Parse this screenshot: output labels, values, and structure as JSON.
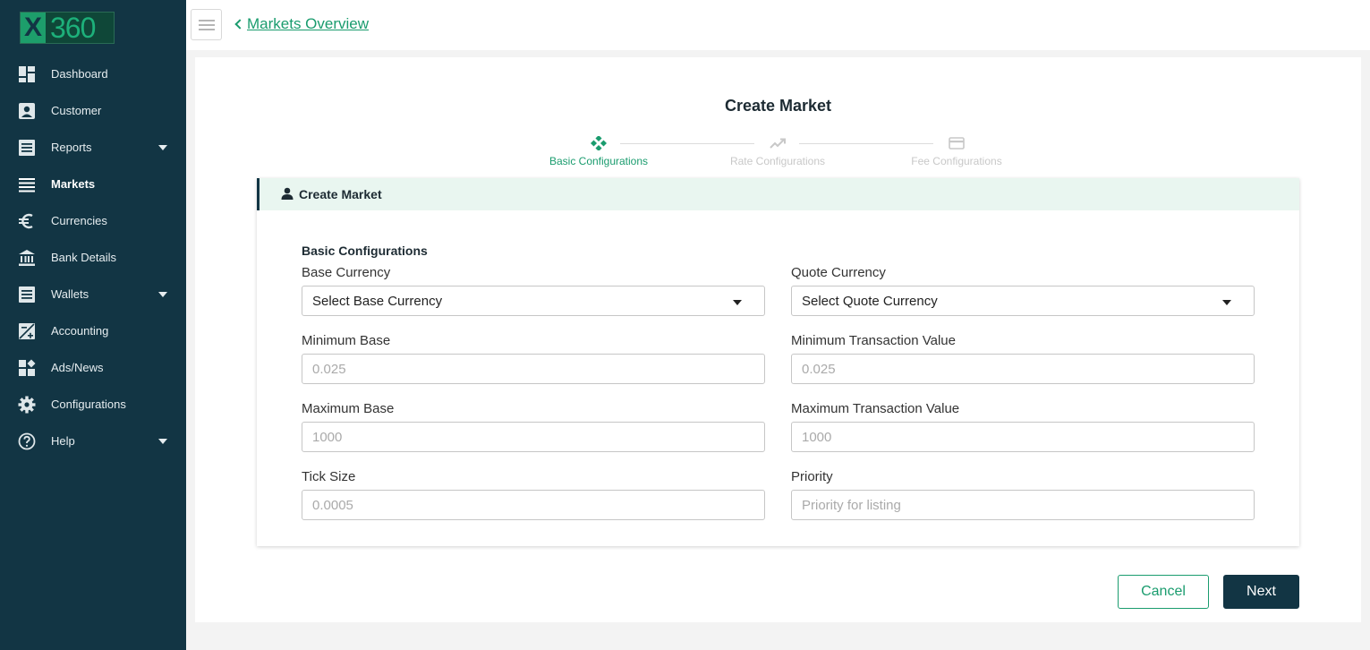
{
  "brand": {
    "logo_x": "X",
    "logo_num": "360"
  },
  "sidebar": {
    "items": [
      {
        "label": "Dashboard",
        "icon": "dashboard-icon",
        "has_caret": false
      },
      {
        "label": "Customer",
        "icon": "customer-icon",
        "has_caret": false
      },
      {
        "label": "Reports",
        "icon": "reports-icon",
        "has_caret": true
      },
      {
        "label": "Markets",
        "icon": "markets-icon",
        "has_caret": false,
        "active": true
      },
      {
        "label": "Currencies",
        "icon": "euro-icon",
        "has_caret": false
      },
      {
        "label": "Bank Details",
        "icon": "bank-icon",
        "has_caret": false
      },
      {
        "label": "Wallets",
        "icon": "wallets-icon",
        "has_caret": true
      },
      {
        "label": "Accounting",
        "icon": "accounting-icon",
        "has_caret": false
      },
      {
        "label": "Ads/News",
        "icon": "ads-news-icon",
        "has_caret": false
      },
      {
        "label": "Configurations",
        "icon": "gear-icon",
        "has_caret": false
      },
      {
        "label": "Help",
        "icon": "help-icon",
        "has_caret": true
      }
    ]
  },
  "header": {
    "back_link": "Markets Overview"
  },
  "page": {
    "title": "Create Market"
  },
  "stepper": [
    {
      "label": "Basic Configurations",
      "icon": "puzzle-icon",
      "active": true
    },
    {
      "label": "Rate Configurations",
      "icon": "trending-up-icon",
      "active": false
    },
    {
      "label": "Fee Configurations",
      "icon": "credit-card-icon",
      "active": false
    }
  ],
  "form": {
    "panel_title": "Create Market",
    "section_title": "Basic Configurations",
    "base_currency": {
      "label": "Base Currency",
      "value": "Select Base Currency"
    },
    "quote_currency": {
      "label": "Quote Currency",
      "value": "Select Quote Currency"
    },
    "minimum_base": {
      "label": "Minimum Base",
      "placeholder": "0.025"
    },
    "minimum_transaction_value": {
      "label": "Minimum Transaction Value",
      "placeholder": "0.025"
    },
    "maximum_base": {
      "label": "Maximum Base",
      "placeholder": "1000"
    },
    "maximum_transaction_value": {
      "label": "Maximum Transaction Value",
      "placeholder": "1000"
    },
    "tick_size": {
      "label": "Tick Size",
      "placeholder": "0.0005"
    },
    "priority": {
      "label": "Priority",
      "placeholder": "Priority for listing"
    }
  },
  "actions": {
    "cancel": "Cancel",
    "next": "Next"
  },
  "colors": {
    "sidebar_bg": "#123544",
    "accent": "#1a9c6e",
    "panel_header_bg": "#e9f6f0"
  }
}
